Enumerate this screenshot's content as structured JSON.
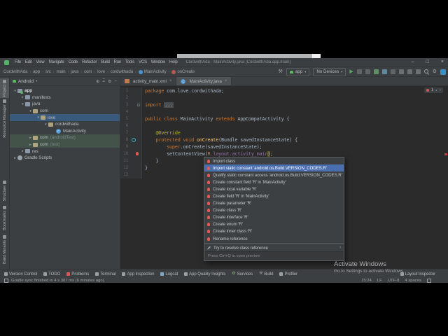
{
  "window": {
    "title": "CordwithAda - MainActivity.java [CordwithAda.app.main]",
    "menus": [
      "File",
      "Edit",
      "View",
      "Navigate",
      "Code",
      "Refactor",
      "Build",
      "Run",
      "Tools",
      "VCS",
      "Window",
      "Help"
    ],
    "controls": {
      "minimize": "–",
      "maximize": "□",
      "close": "×"
    }
  },
  "toolbar": {
    "breadcrumbs": [
      {
        "label": "CordwithAda"
      },
      {
        "label": "app"
      },
      {
        "label": "src"
      },
      {
        "label": "main"
      },
      {
        "label": "java"
      },
      {
        "label": "com"
      },
      {
        "label": "love"
      },
      {
        "label": "cordwithada"
      },
      {
        "label": "MainActivity",
        "icon": "class"
      },
      {
        "label": "onCreate",
        "icon": "method"
      }
    ],
    "actions": [
      {
        "name": "build-hammer",
        "kind": "glyph",
        "glyph": "⚒",
        "color": "#9da2a6"
      },
      {
        "name": "run-configuration",
        "kind": "chip",
        "label": "app",
        "icon": "android",
        "caret": "▾"
      },
      {
        "name": "device-selector",
        "kind": "chip",
        "label": "No Devices",
        "caret": "▾"
      },
      {
        "name": "run",
        "kind": "glyph",
        "glyph": "▶",
        "color": "#59a869"
      },
      {
        "name": "apply-changes",
        "kind": "sq",
        "color": "#5f6467"
      },
      {
        "name": "apply-code-changes",
        "kind": "sq",
        "color": "#5f6467"
      },
      {
        "name": "debug",
        "kind": "sq",
        "color": "#5f8f63"
      },
      {
        "name": "profile",
        "kind": "sq",
        "color": "#5f87a0"
      },
      {
        "name": "stop",
        "kind": "sq",
        "color": "#5f6467"
      },
      {
        "name": "device-manager",
        "kind": "sq",
        "color": "#6a6f73"
      },
      {
        "name": "sync-project",
        "kind": "sq",
        "color": "#6a6f73"
      },
      {
        "name": "sdk-manager",
        "kind": "sq",
        "color": "#6a6f73"
      },
      {
        "name": "search-everywhere",
        "kind": "search"
      },
      {
        "name": "settings",
        "kind": "glyph",
        "glyph": "⚙",
        "color": "#9da2a6"
      },
      {
        "name": "notifications",
        "kind": "badge"
      }
    ]
  },
  "left_stripe": {
    "top": [
      "Project",
      "Resource Manager"
    ],
    "bottom": [
      "Structure",
      "Bookmarks",
      "Build Variants"
    ]
  },
  "project": {
    "header": {
      "label": "Android",
      "caret": "▾",
      "icons": [
        "locate",
        "collapse-all",
        "settings",
        "hide"
      ]
    },
    "header_glyphs": [
      "⊕",
      "Ξ",
      "⚙",
      "−"
    ],
    "tree": [
      {
        "label": "app",
        "indent": 1,
        "icon": "android-module",
        "chev": "▾",
        "bold": true
      },
      {
        "label": "manifests",
        "indent": 2,
        "icon": "folder",
        "chev": "▸"
      },
      {
        "label": "java",
        "indent": 2,
        "icon": "folder",
        "chev": "▾"
      },
      {
        "label": "com",
        "indent": 3,
        "icon": "package",
        "chev": "▾"
      },
      {
        "label": "love",
        "indent": 4,
        "icon": "package",
        "chev": "▾",
        "selected": true
      },
      {
        "label": "cordwithada",
        "indent": 5,
        "icon": "package",
        "chev": "▾"
      },
      {
        "label": "MainActivity",
        "indent": 6,
        "icon": "class",
        "chev": ""
      },
      {
        "label": "com",
        "suffix": "(androidTest)",
        "indent": 3,
        "icon": "package",
        "chev": "▸",
        "tint": true
      },
      {
        "label": "com",
        "suffix": "(test)",
        "indent": 3,
        "icon": "package",
        "chev": "▸",
        "tint": true
      },
      {
        "label": "res",
        "indent": 2,
        "icon": "folder",
        "chev": "▸"
      },
      {
        "label": "Gradle Scripts",
        "indent": 1,
        "icon": "gradle",
        "chev": "▸"
      }
    ]
  },
  "editor": {
    "tabs": [
      {
        "label": "activity_main.xml",
        "icon": "xml-file",
        "close": "×",
        "selected": false
      },
      {
        "label": "MainActivity.java",
        "icon": "class",
        "close": "×",
        "selected": true
      }
    ],
    "inspection": {
      "errors": "1",
      "up": "▴",
      "down": "▾"
    },
    "code": {
      "lines": [
        {
          "n": "1",
          "g": "",
          "t": [
            [
              "k",
              "package"
            ],
            [
              "t",
              " com.love.cordwithada;"
            ]
          ]
        },
        {
          "n": "2",
          "g": "",
          "t": []
        },
        {
          "n": "3",
          "g": "fold",
          "t": [
            [
              "k",
              "import "
            ],
            [
              "d",
              "..."
            ]
          ]
        },
        {
          "n": "4",
          "g": "",
          "t": []
        },
        {
          "n": "5",
          "g": "",
          "t": [
            [
              "k",
              "public class "
            ],
            [
              "t",
              "MainActivity "
            ],
            [
              "k",
              "extends "
            ],
            [
              "t",
              "AppCompatActivity {"
            ]
          ]
        },
        {
          "n": "6",
          "g": "",
          "t": []
        },
        {
          "n": "7",
          "g": "",
          "t": [
            [
              "a",
              "    @Override"
            ]
          ]
        },
        {
          "n": "8",
          "g": "override",
          "t": [
            [
              "k",
              "    protected void "
            ],
            [
              "m",
              "onCreate"
            ],
            [
              "t",
              "(Bundle savedInstanceState) {"
            ]
          ]
        },
        {
          "n": "9",
          "g": "",
          "t": [
            [
              "k",
              "        super"
            ],
            [
              "t",
              ".onCreate(savedInstanceState);"
            ]
          ]
        },
        {
          "n": "10",
          "g": "bulb",
          "t": [
            [
              "t",
              "        setContentView("
            ],
            [
              "e",
              "R"
            ],
            [
              "f",
              ".layout.activity_main"
            ],
            [
              "b",
              ")"
            ],
            [
              "t",
              ";"
            ]
          ]
        },
        {
          "n": "11",
          "g": "",
          "t": [
            [
              "t",
              "    }"
            ]
          ]
        },
        {
          "n": "12",
          "g": "",
          "t": [
            [
              "t",
              "}"
            ]
          ]
        },
        {
          "n": "13",
          "g": "",
          "t": []
        }
      ]
    }
  },
  "popup": {
    "items": [
      {
        "icon": "bulb",
        "label": "Import class"
      },
      {
        "icon": "bulb",
        "label": "Import static constant 'android.os.Build.VERSION_CODES.R'",
        "selected": true
      },
      {
        "icon": "bulb",
        "label": "Qualify static constant access 'android.os.Build.VERSION_CODES.R'"
      },
      {
        "icon": "bulb",
        "label": "Create constant field 'R' in 'MainActivity'"
      },
      {
        "icon": "bulb",
        "label": "Create local variable 'R'"
      },
      {
        "icon": "bulb",
        "label": "Create field 'R' in 'MainActivity'"
      },
      {
        "icon": "bulb",
        "label": "Create parameter 'R'"
      },
      {
        "icon": "bulb",
        "label": "Create class 'R'"
      },
      {
        "icon": "bulb",
        "label": "Create interface 'R'"
      },
      {
        "icon": "bulb",
        "label": "Create enum 'R'"
      },
      {
        "icon": "bulb",
        "label": "Create inner class 'R'"
      },
      {
        "icon": "bulb",
        "label": "Rename reference"
      },
      {
        "separator": true
      },
      {
        "icon": "pencil",
        "label": "Try to resolve class reference",
        "submenu": "›"
      }
    ],
    "footer": "Press Ctrl+Q to open preview"
  },
  "bottom_bar": {
    "left": [
      {
        "label": "Version Control",
        "icon": "version-control",
        "color": "#9aa0a4"
      },
      {
        "label": "TODO",
        "icon": "todo",
        "color": "#9aa0a4"
      },
      {
        "label": "Problems",
        "icon": "problems",
        "color": "#e05555"
      },
      {
        "label": "Terminal",
        "icon": "terminal",
        "color": "#9aa0a4"
      },
      {
        "label": "App Inspection",
        "icon": "app-inspection",
        "color": "#9aa0a4"
      },
      {
        "label": "Logcat",
        "icon": "logcat",
        "color": "#7fa8c9"
      },
      {
        "label": "App Quality Insights",
        "icon": "app-quality-insights",
        "color": "#9aa0a4"
      },
      {
        "label": "Services",
        "icon": "services",
        "glyph": "⚙",
        "color": "#8fb573"
      },
      {
        "label": "Build",
        "icon": "build",
        "glyph": "⚒",
        "color": "#9aa0a4"
      },
      {
        "label": "Profiler",
        "icon": "profiler",
        "color": "#9aa0a4"
      }
    ],
    "right": [
      {
        "label": "Layout Inspector",
        "icon": "layout-inspector",
        "color": "#9aa0a4"
      }
    ]
  },
  "status_bar": {
    "left": "Gradle sync finished in 4 s 387 ms (6 minutes ago)",
    "right": [
      "15:24",
      "LF",
      "UTF-8",
      "4 spaces"
    ]
  },
  "watermark": {
    "line1": "Activate Windows",
    "line2": "Go to Settings to activate Windows"
  },
  "colors": {
    "selection_blue": "#4b6eaf",
    "tree_selection": "#3a5a7d",
    "android_green": "#5fb865",
    "error_red": "#e05555",
    "run_green": "#59a869",
    "editor_bg": "#2b2b2b",
    "panel_bg": "#3c3f41"
  }
}
